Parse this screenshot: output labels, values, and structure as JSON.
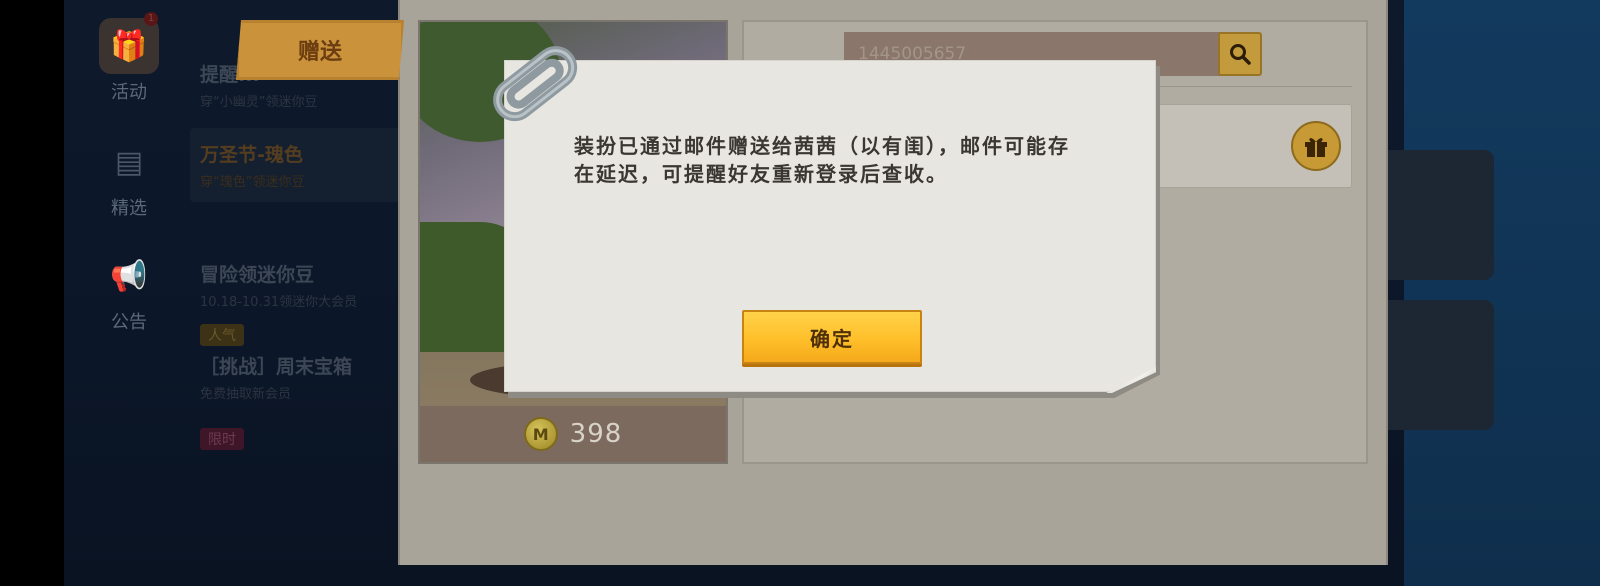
{
  "sidebar": {
    "items": [
      {
        "label": "活动",
        "icon": "gift-icon",
        "badge": "1"
      },
      {
        "label": "精选",
        "icon": "document-icon"
      },
      {
        "label": "公告",
        "icon": "megaphone-icon"
      }
    ]
  },
  "event_menu": {
    "entries": [
      {
        "title": "提醒...",
        "subtitle": "穿“小幽灵”领迷你豆"
      },
      {
        "title": "万圣节-瑰色",
        "subtitle": "穿“瑰色”领迷你豆",
        "active": true
      },
      {
        "title": "冒险领迷你豆",
        "subtitle": "10.18-10.31领迷你大会员"
      },
      {
        "tag": "人气",
        "title": "［挑战］周末宝箱",
        "subtitle": "免费抽取新会员"
      },
      {
        "tag": "限时"
      }
    ]
  },
  "gift_panel": {
    "tab_label": "赠送",
    "item_price": "398",
    "coin_symbol": "M",
    "search": {
      "value": "1445005657",
      "icon": "search-icon"
    },
    "friend_action_icon": "gift-icon"
  },
  "dialog": {
    "message": "装扮已通过邮件赠送给茜茜（以有闺），邮件可能存在延迟，可提醒好友重新登录后查收。",
    "confirm_label": "确定",
    "decoration_icon": "paperclip-icon"
  },
  "colors": {
    "confirm_button": "#ffc833",
    "dialog_paper": "#e8e6e1",
    "tab_gold": "#c9923b"
  }
}
